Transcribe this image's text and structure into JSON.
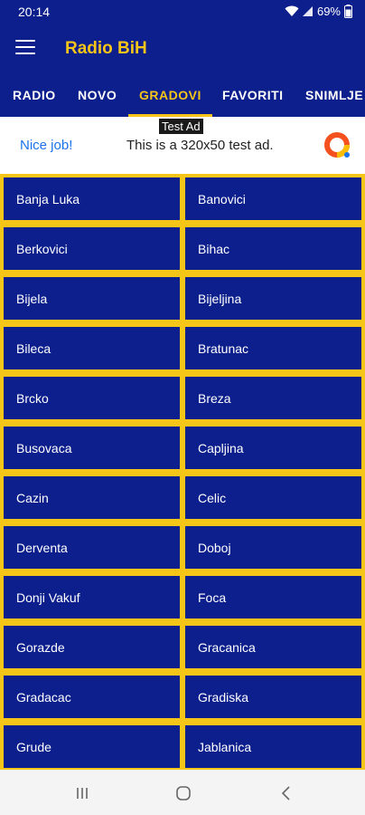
{
  "status": {
    "time": "20:14",
    "battery": "69%"
  },
  "app": {
    "title": "Radio BiH"
  },
  "tabs": [
    {
      "label": "RADIO",
      "active": false
    },
    {
      "label": "NOVO",
      "active": false
    },
    {
      "label": "GRADOVI",
      "active": true
    },
    {
      "label": "FAVORITI",
      "active": false
    },
    {
      "label": "SNIMLJE",
      "active": false
    }
  ],
  "ad": {
    "badge": "Test Ad",
    "left_text": "Nice job!",
    "text": "This is a 320x50 test ad."
  },
  "cities": [
    "Banja Luka",
    "Banovici",
    "Berkovici",
    "Bihac",
    "Bijela",
    "Bijeljina",
    "Bileca",
    "Bratunac",
    "Brcko",
    "Breza",
    "Busovaca",
    "Capljina",
    "Cazin",
    "Celic",
    "Derventa",
    "Doboj",
    "Donji Vakuf",
    "Foca",
    "Gorazde",
    "Gracanica",
    "Gradacac",
    "Gradiska",
    "Grude",
    "Jablanica"
  ],
  "colors": {
    "primary": "#0d1f8c",
    "accent": "#f5c518"
  },
  "icons": {
    "menu": "hamburger-menu-icon",
    "nav": [
      "recents-icon",
      "home-icon",
      "back-icon"
    ]
  }
}
